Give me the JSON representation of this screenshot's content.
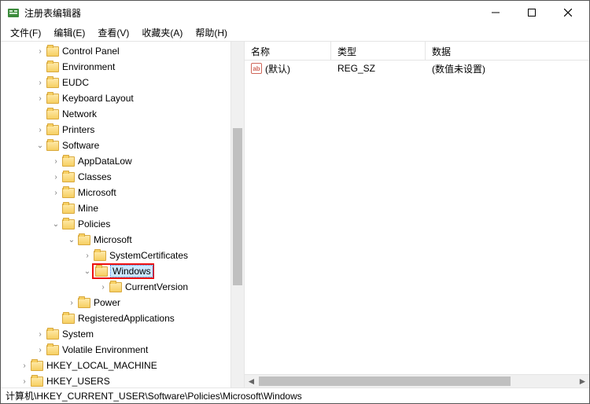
{
  "window": {
    "title": "注册表编辑器"
  },
  "menu": {
    "file": "文件(F)",
    "edit": "编辑(E)",
    "view": "查看(V)",
    "favorites": "收藏夹(A)",
    "help": "帮助(H)"
  },
  "tree": {
    "control_panel": "Control Panel",
    "environment": "Environment",
    "eudc": "EUDC",
    "keyboard_layout": "Keyboard Layout",
    "network": "Network",
    "printers": "Printers",
    "software": "Software",
    "appdatalow": "AppDataLow",
    "classes": "Classes",
    "microsoft": "Microsoft",
    "mine": "Mine",
    "policies": "Policies",
    "policies_microsoft": "Microsoft",
    "system_certificates": "SystemCertificates",
    "windows": "Windows",
    "current_version": "CurrentVersion",
    "power": "Power",
    "registered_applications": "RegisteredApplications",
    "system": "System",
    "volatile_environment": "Volatile Environment",
    "hklm": "HKEY_LOCAL_MACHINE",
    "hku": "HKEY_USERS"
  },
  "list": {
    "headers": {
      "name": "名称",
      "type": "类型",
      "data": "数据"
    },
    "rows": [
      {
        "icon": "ab",
        "name": "(默认)",
        "type": "REG_SZ",
        "data": "(数值未设置)"
      }
    ]
  },
  "statusbar": {
    "path": "计算机\\HKEY_CURRENT_USER\\Software\\Policies\\Microsoft\\Windows"
  },
  "glyph": {
    "collapsed": "›",
    "expanded": "⌄",
    "leftarrow": "◄",
    "rightarrow": "►"
  }
}
